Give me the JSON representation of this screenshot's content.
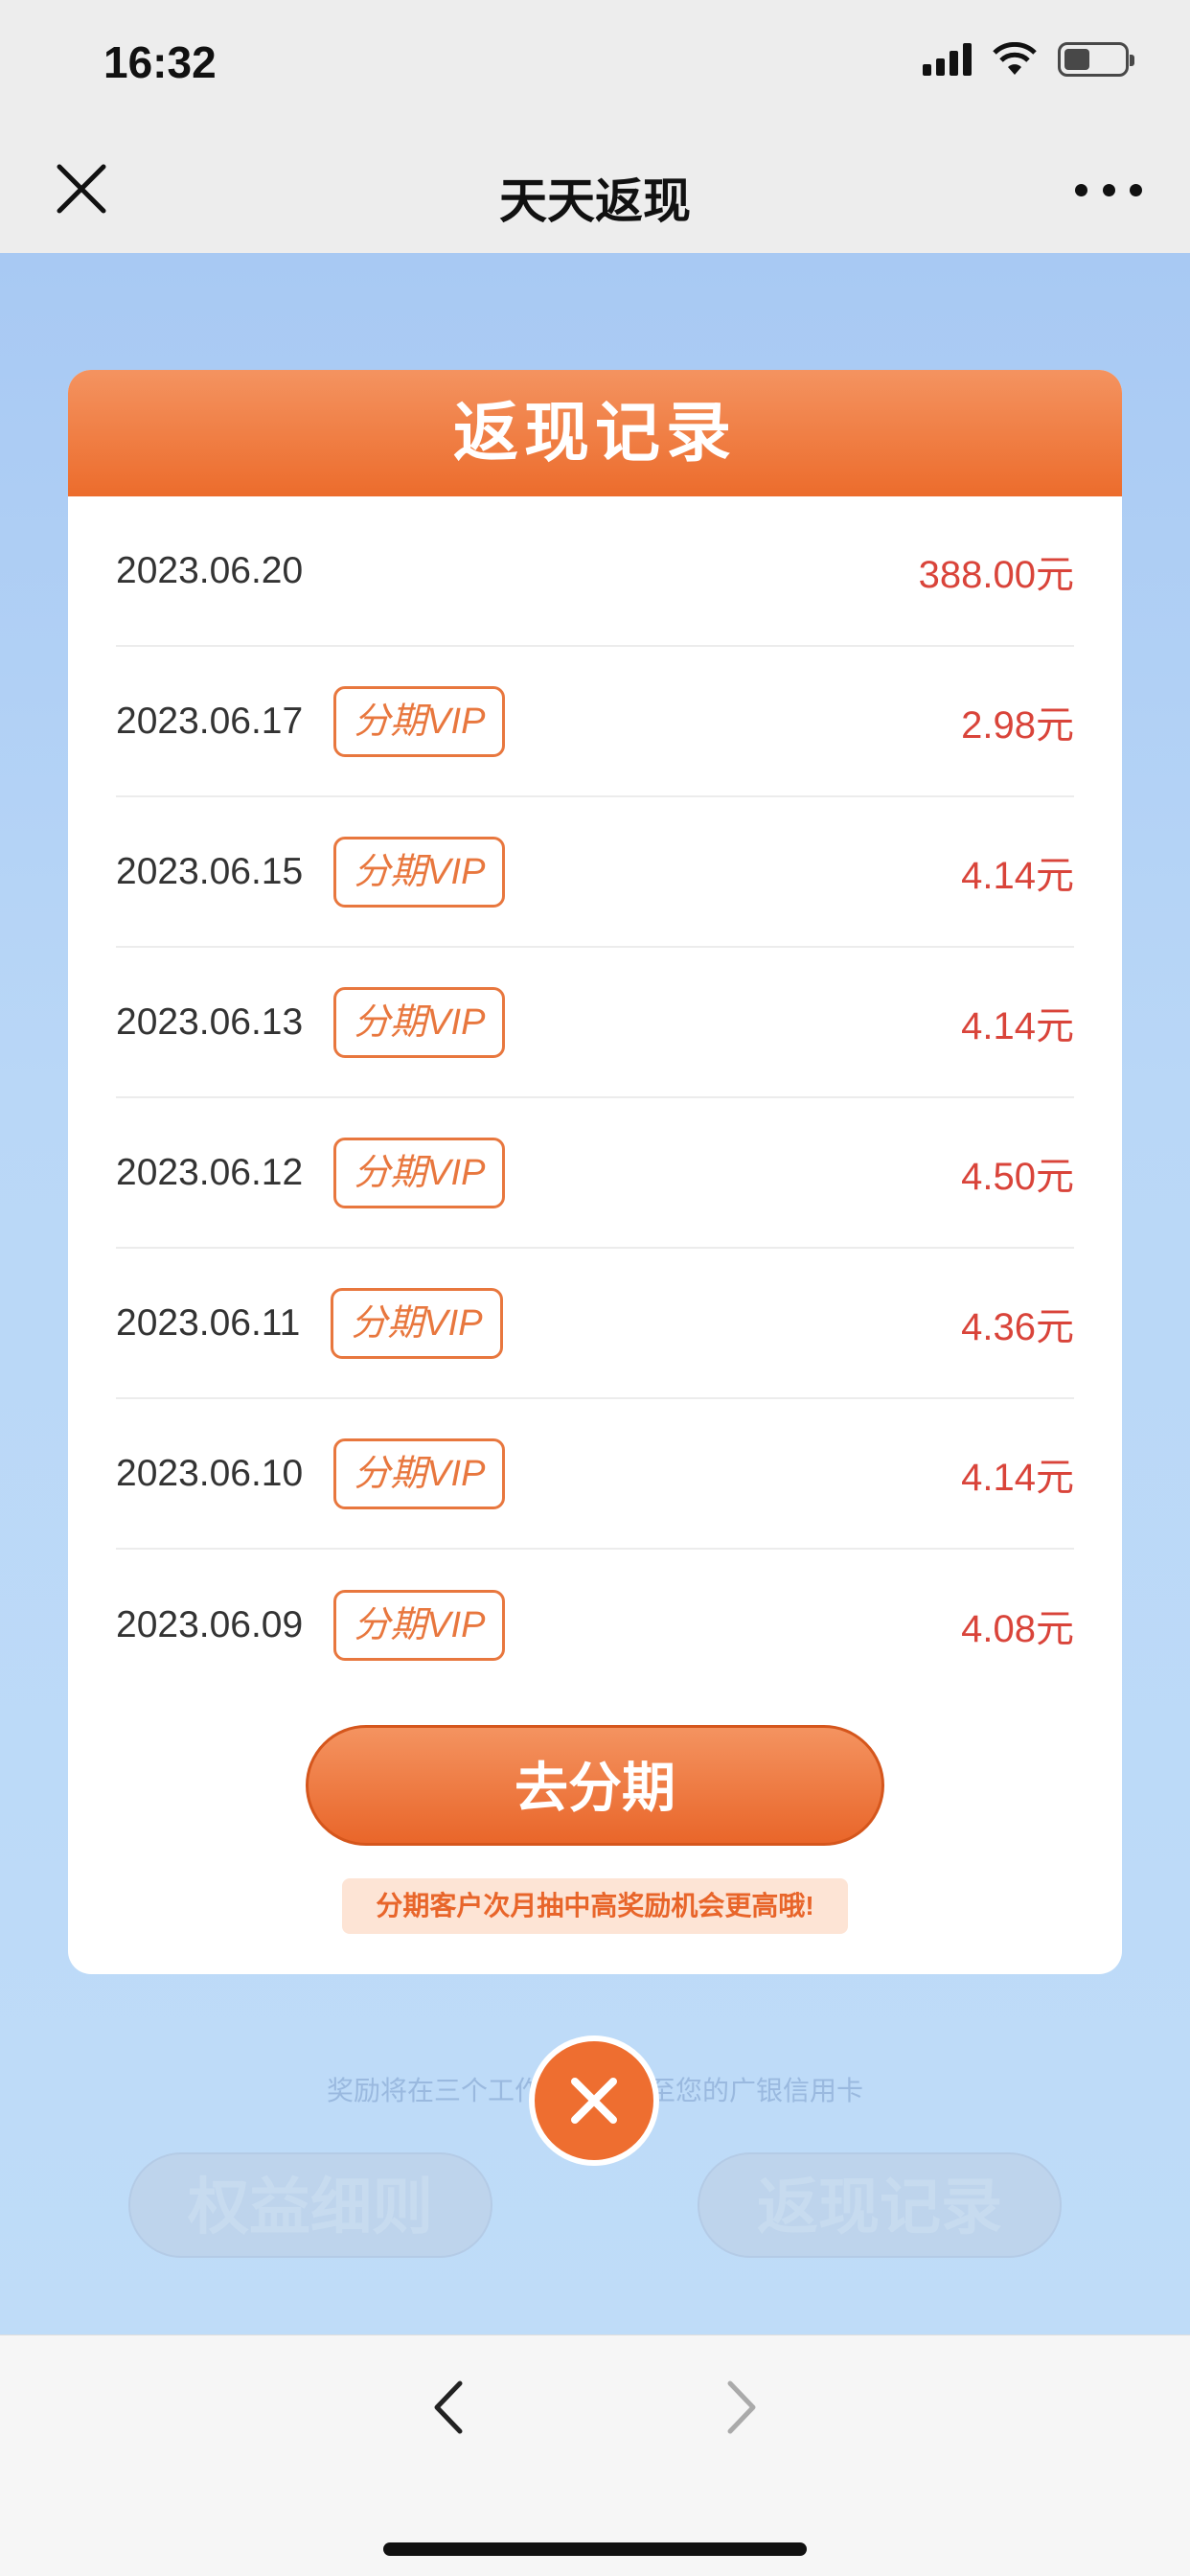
{
  "status_bar": {
    "time": "16:32"
  },
  "navbar": {
    "title": "天天返现",
    "close_icon": "close-icon",
    "more_icon": "more-icon"
  },
  "dialog": {
    "title": "返现记录",
    "records": [
      {
        "date": "2023.06.20",
        "tag": "",
        "amount": "388.00元"
      },
      {
        "date": "2023.06.17",
        "tag": "分期VIP",
        "amount": "2.98元"
      },
      {
        "date": "2023.06.15",
        "tag": "分期VIP",
        "amount": "4.14元"
      },
      {
        "date": "2023.06.13",
        "tag": "分期VIP",
        "amount": "4.14元"
      },
      {
        "date": "2023.06.12",
        "tag": "分期VIP",
        "amount": "4.50元"
      },
      {
        "date": "2023.06.11",
        "tag": "分期VIP",
        "amount": "4.36元"
      },
      {
        "date": "2023.06.10",
        "tag": "分期VIP",
        "amount": "4.14元"
      },
      {
        "date": "2023.06.09",
        "tag": "分期VIP",
        "amount": "4.08元"
      }
    ],
    "go_button": "去分期",
    "hint": "分期客户次月抽中高奖励机会更高哦!"
  },
  "background": {
    "notice": "奖励将在三个工作日内发放至您的广银信用卡",
    "btn_rules": "权益细则",
    "btn_records": "返现记录"
  },
  "colors": {
    "accent": "#ec6c2c",
    "amount": "#d9443a"
  }
}
